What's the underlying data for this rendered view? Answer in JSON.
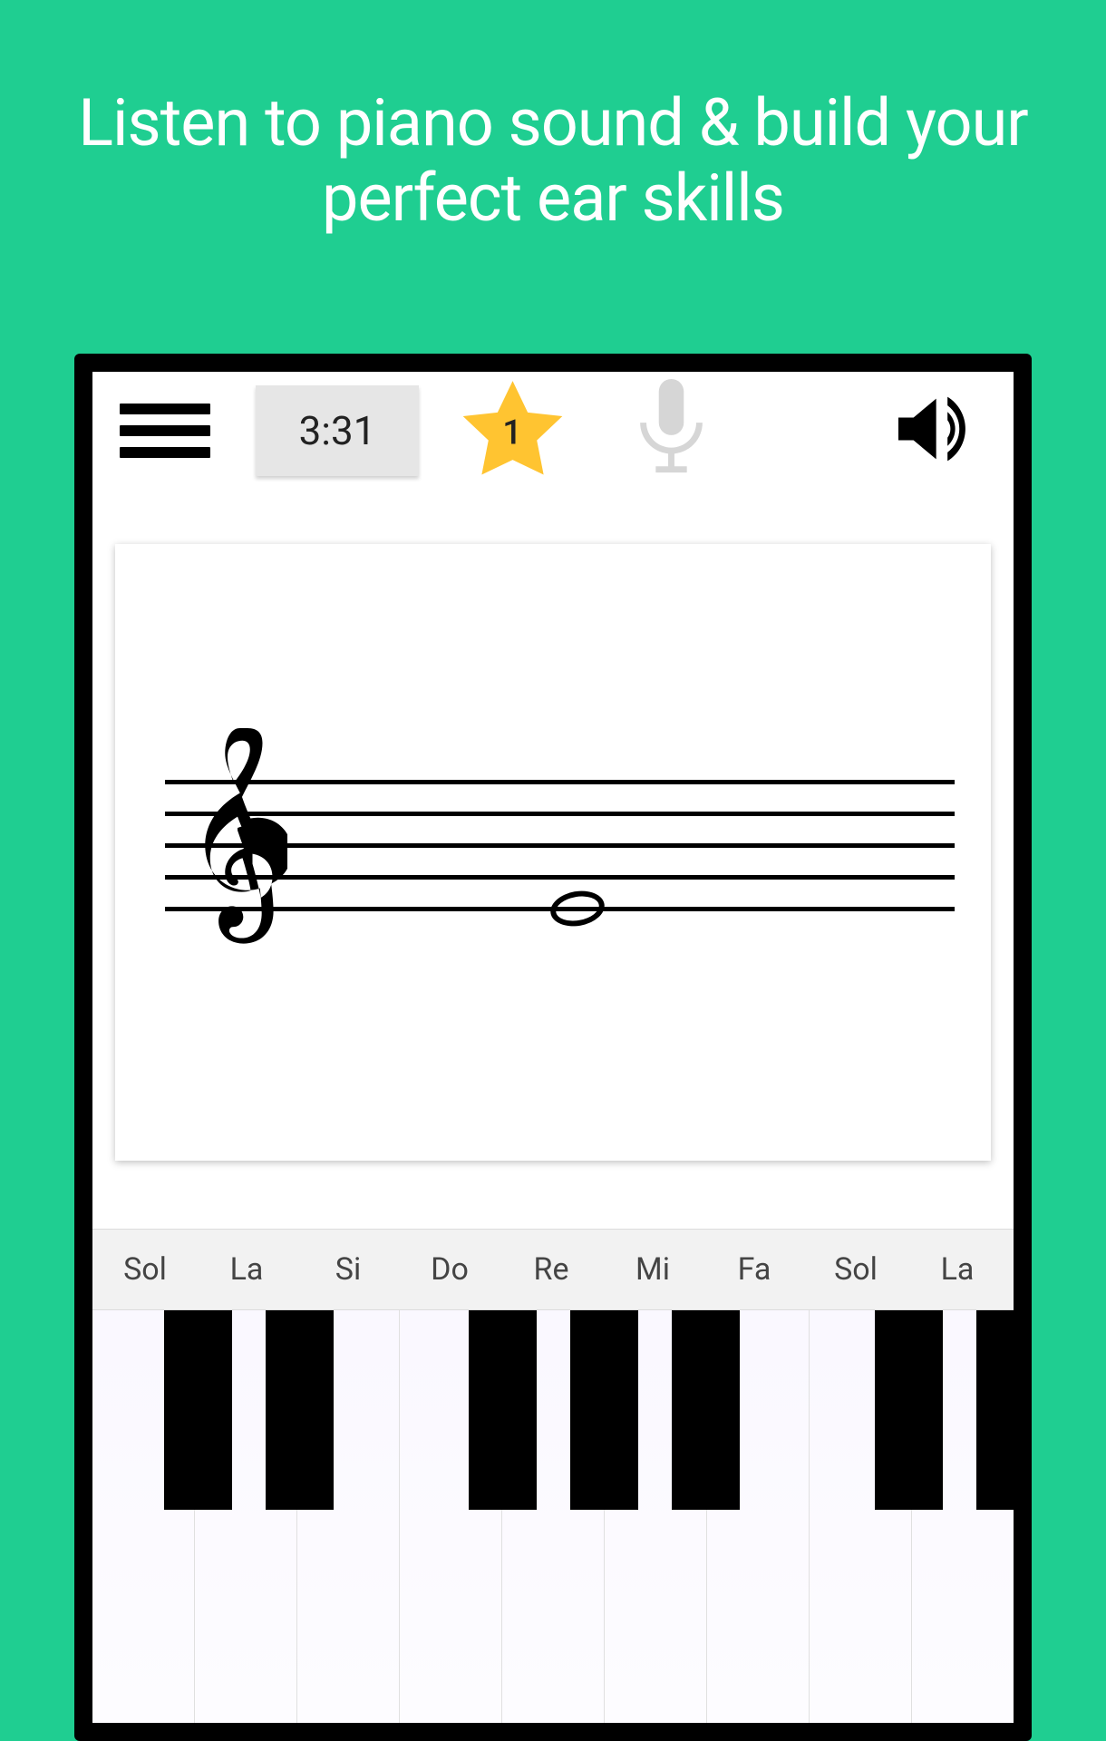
{
  "headline": "Listen to piano sound & build your perfect ear skills",
  "toolbar": {
    "timer": "3:31",
    "star_count": "1"
  },
  "note_labels": [
    "Sol",
    "La",
    "Si",
    "Do",
    "Re",
    "Mi",
    "Fa",
    "Sol",
    "La"
  ]
}
